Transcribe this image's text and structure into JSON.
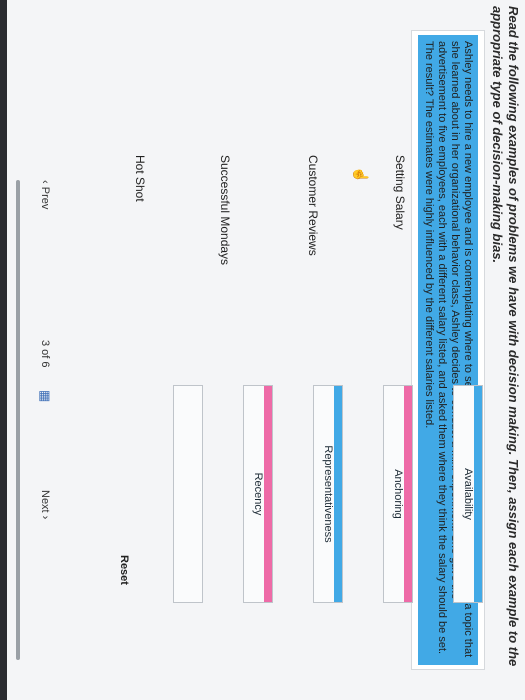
{
  "prompt": "Read the following examples of problems we have with decision making. Then, assign each example to the appropriate type of decision-making bias.",
  "scenario_text": "Ashley needs to hire a new employee and is contemplating where to set the salary in the advertisement. To explore a topic that she learned about in her organizational behavior class, Ashley decides to conduct a mini-experiment. She gave the advertisement to five employees, each with a different salary listed, and asked them where they think the salary should be set. The result? The estimates were highly influenced by the different salaries listed.",
  "examples": [
    {
      "label": "Setting Salary"
    },
    {
      "label": "Customer Reviews"
    },
    {
      "label": "Successful Mondays"
    },
    {
      "label": "Hot Shot"
    }
  ],
  "bins": [
    {
      "label": "Availability",
      "color": "#41a9e6"
    },
    {
      "label": "Anchoring",
      "color": "#ee6aa7"
    },
    {
      "label": "Representativeness",
      "color": "#41a9e6"
    },
    {
      "label": "Recency",
      "color": "#ee6aa7"
    },
    {
      "label": "",
      "color": "#ffffff"
    }
  ],
  "reset_label": "Reset",
  "pager": {
    "prev_label": "Prev",
    "page_text": "3 of 6",
    "next_label": "Next",
    "grid_icon": "grid-icon"
  },
  "colors": {
    "accent_blue": "#41a9e6",
    "accent_pink": "#ee6aa7"
  }
}
